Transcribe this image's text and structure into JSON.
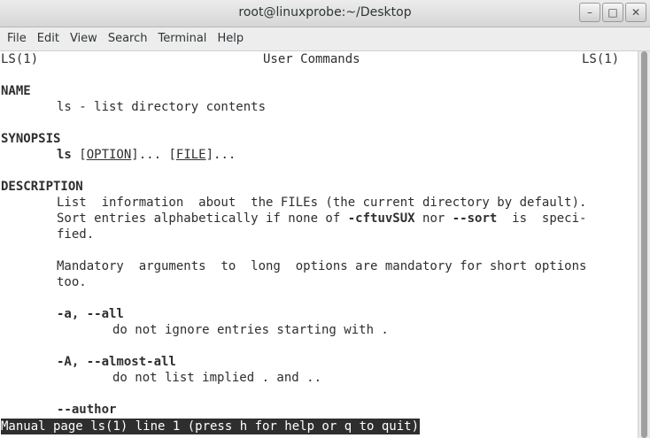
{
  "window": {
    "title": "root@linuxprobe:~/Desktop",
    "buttons": {
      "minimize_glyph": "–",
      "maximize_glyph": "□",
      "close_glyph": "✕"
    }
  },
  "menu": {
    "items": [
      "File",
      "Edit",
      "View",
      "Search",
      "Terminal",
      "Help"
    ]
  },
  "man": {
    "header_left": "LS(1)",
    "header_center": "User Commands",
    "header_right": "LS(1)",
    "name_heading": "NAME",
    "name_text": "ls - list directory contents",
    "synopsis_heading": "SYNOPSIS",
    "synopsis_cmd": "ls",
    "synopsis_option": "OPTION",
    "synopsis_ellipsis1": "... ",
    "synopsis_file": "FILE",
    "synopsis_ellipsis2": "...",
    "description_heading": "DESCRIPTION",
    "desc_line1": "List  information  about  the FILEs (the current directory by default).",
    "desc_line2_a": "Sort entries alphabetically if none of ",
    "desc_line2_flags": "-cftuvSUX",
    "desc_line2_b": " nor ",
    "desc_line2_sort": "--sort",
    "desc_line2_c": "  is  speci-",
    "desc_line3": "fied.",
    "desc_line4": "Mandatory  arguments  to  long  options are mandatory for short options",
    "desc_line5": "too.",
    "opt_all": "-a, --all",
    "opt_all_desc": "do not ignore entries starting with .",
    "opt_almost_all": "-A, --almost-all",
    "opt_almost_all_desc": "do not list implied . and ..",
    "opt_author": "--author"
  },
  "status": {
    "text": "Manual page ls(1) line 1 (press h for help or q to quit)"
  }
}
